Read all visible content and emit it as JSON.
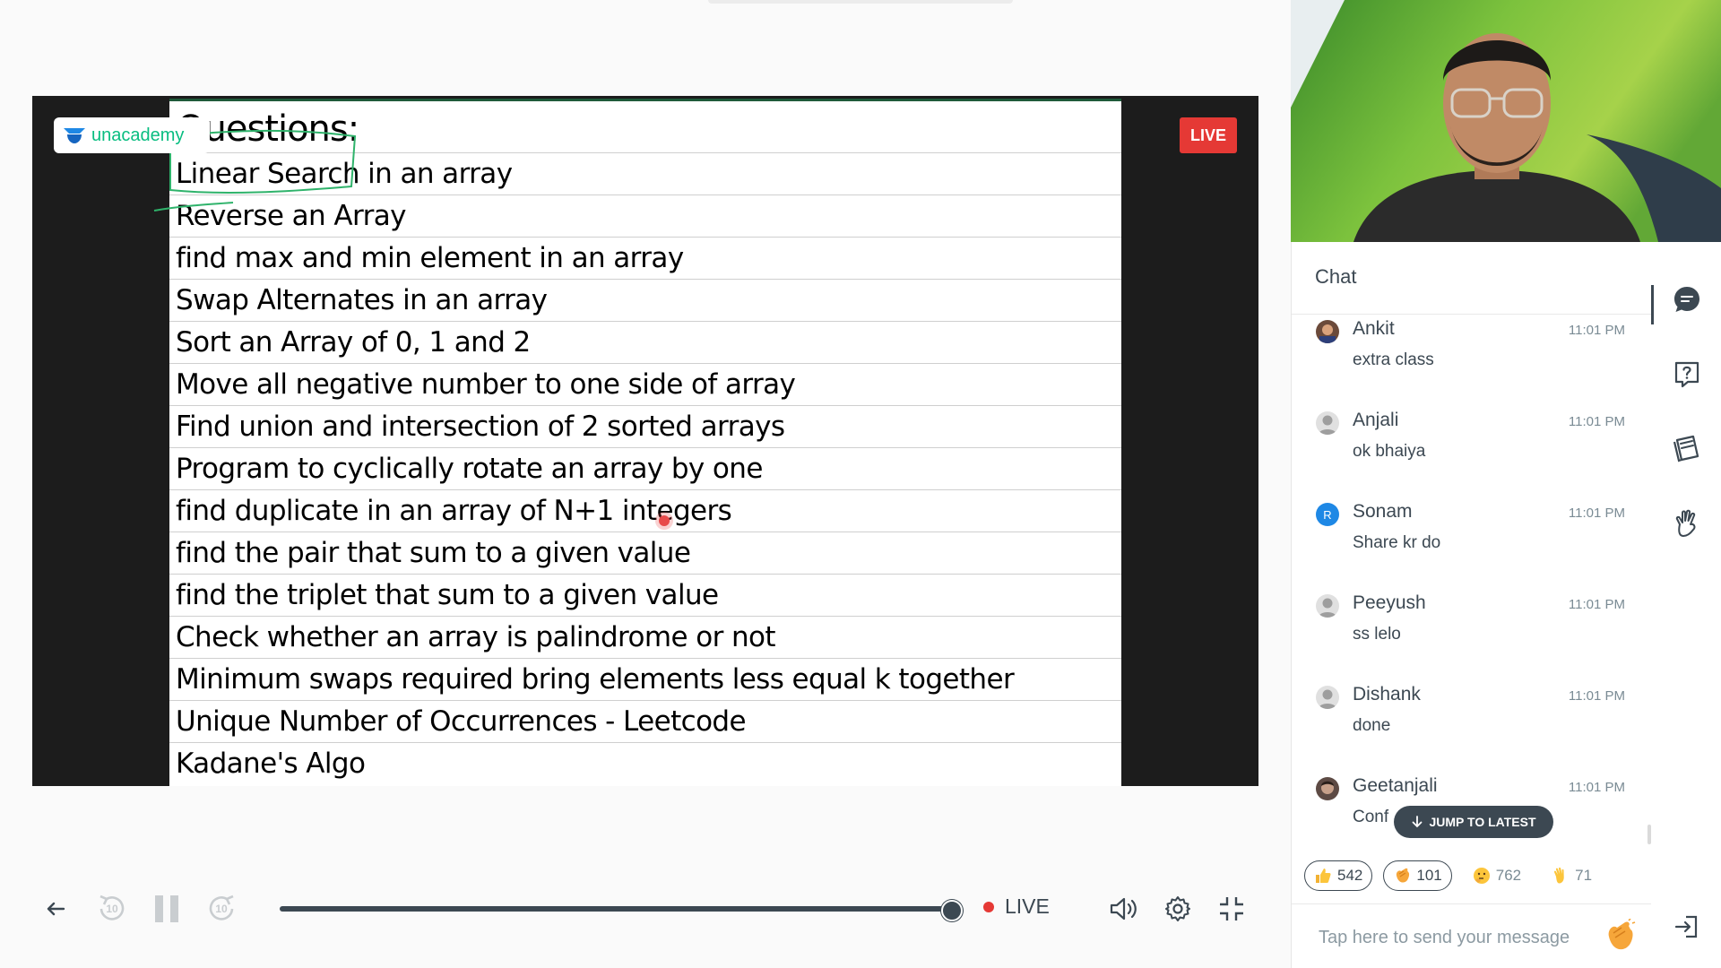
{
  "player": {
    "live_badge": "LIVE",
    "live_indicator": "LIVE",
    "rewind_label": "10",
    "forward_label": "10",
    "seek_fraction": 1.0
  },
  "logo": {
    "text": "unacademy"
  },
  "slide": {
    "title": "Questions:",
    "items": [
      "Linear Search in an array",
      "Reverse an Array",
      "find max and min element in an array",
      "Swap Alternates in an array",
      "Sort an Array of 0, 1 and 2",
      "Move all negative number to one side of array",
      "Find union and intersection of 2 sorted arrays",
      "Program to cyclically rotate an array by one",
      "find duplicate in an array of N+1 integers",
      "find the pair that sum to a given value",
      "find the triplet that sum to a given value",
      "Check whether an array is palindrome or not",
      "Minimum swaps required bring elements less equal k together",
      "Unique Number of Occurrences - Leetcode",
      "Kadane's Algo"
    ]
  },
  "chat": {
    "title": "Chat",
    "messages": [
      {
        "name": "Ankit",
        "time": "11:01 PM",
        "text": "extra class"
      },
      {
        "name": "Anjali",
        "time": "11:01 PM",
        "text": "ok bhaiya"
      },
      {
        "name": "Sonam",
        "time": "11:01 PM",
        "text": "Share kr do",
        "avatar_letter": "R"
      },
      {
        "name": "Peeyush",
        "time": "11:01 PM",
        "text": "ss lelo"
      },
      {
        "name": "Dishank",
        "time": "11:01 PM",
        "text": "done"
      },
      {
        "name": "Geetanjali",
        "time": "11:01 PM",
        "text": "Conf"
      }
    ],
    "jump_label": "JUMP TO LATEST",
    "reactions": [
      {
        "icon": "thumbs-up-icon",
        "count": "542"
      },
      {
        "icon": "clap-icon",
        "count": "101"
      },
      {
        "icon": "thinking-face-icon",
        "count": "762"
      },
      {
        "icon": "waving-hand-icon",
        "count": "71"
      }
    ],
    "input_placeholder": "Tap here to send your message"
  },
  "colors": {
    "brand_green": "#08bd80",
    "live_red": "#e53935",
    "text_dark": "#3c4852"
  }
}
